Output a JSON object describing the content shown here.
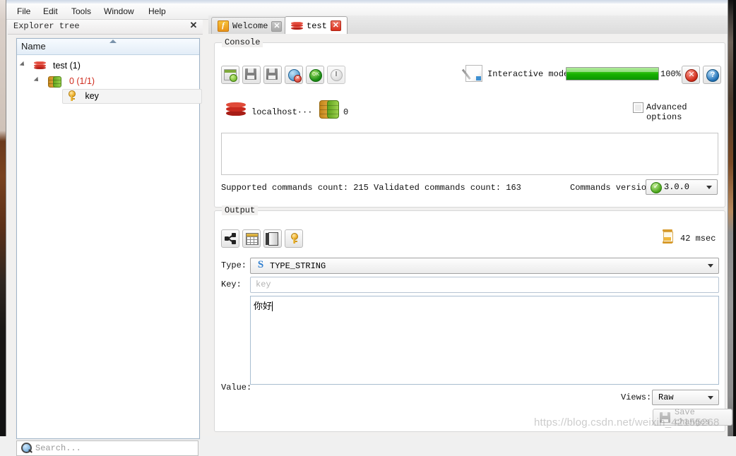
{
  "menubar": {
    "items": [
      "File",
      "Edit",
      "Tools",
      "Window",
      "Help"
    ]
  },
  "explorer": {
    "panel_title": "Explorer tree",
    "close_label": "✕",
    "column_header": "Name",
    "nodes": [
      {
        "label": "test (1)",
        "icon": "redis-icon",
        "depth": 0
      },
      {
        "label": "0 (1/1)",
        "icon": "database-icon",
        "depth": 1
      },
      {
        "label": "key",
        "icon": "key-icon",
        "depth": 2
      }
    ],
    "search_placeholder": "Search..."
  },
  "tabs": [
    {
      "label": "Welcome",
      "icon": "welcome-icon",
      "close": "✕",
      "active": false
    },
    {
      "label": "test",
      "icon": "redis-icon",
      "close": "✕",
      "active": true
    }
  ],
  "console": {
    "group_label": "Console",
    "toolbar": [
      {
        "name": "export-button"
      },
      {
        "name": "save-button"
      },
      {
        "name": "save-as-button"
      },
      {
        "name": "disconnect-button"
      },
      {
        "name": "connect-button"
      },
      {
        "name": "power-button"
      }
    ],
    "interactive_mode_label": "Interactive mode",
    "progress_value": 100,
    "progress_label": "100%",
    "stop_button": "stop-button",
    "help_button": "help-button",
    "server_name": "localhost···",
    "database_index": "0",
    "advanced_options_label": "Advanced options",
    "advanced_options_checked": false,
    "output_text": "",
    "status_text": "Supported commands count: 215 Validated commands count: 163",
    "commands_version_label": "Commands version:",
    "commands_version_value": "3.0.0"
  },
  "output": {
    "group_label": "Output",
    "toolbar": [
      {
        "name": "share-button"
      },
      {
        "name": "table-view-button"
      },
      {
        "name": "exit-button"
      },
      {
        "name": "key-button"
      }
    ],
    "elapsed_label": "42 msec",
    "type_label": "Type:",
    "type_value": "TYPE_STRING",
    "type_icon_char": "S",
    "key_label": "Key:",
    "key_placeholder": "key",
    "value_label": "Value:",
    "value_text": "你好",
    "views_label": "Views:",
    "views_value": "Raw",
    "save_changes_label": "Save changes",
    "save_changes_enabled": false
  },
  "watermark": {
    "text": "https://blog.csdn.net/weixin_42155268"
  },
  "colors": {
    "accent_green": "#17b100",
    "redis_red": "#c82a1f",
    "tab_active_bg": "#ffffff",
    "panel_bg": "#f1f0ef",
    "tree_header": "#e3edf7"
  }
}
